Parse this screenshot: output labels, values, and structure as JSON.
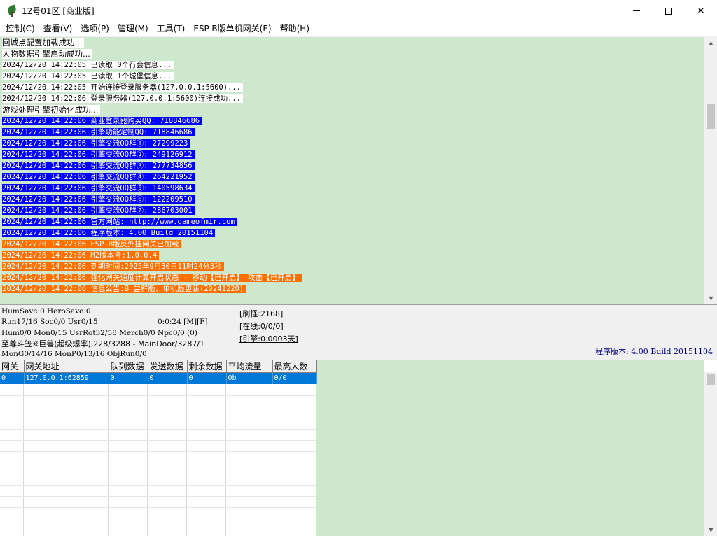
{
  "window": {
    "title": "12号01区 [商业版]",
    "app_icon": "tree-leaf-icon",
    "controls": {
      "minimize": "minimize-icon",
      "maximize": "maximize-icon",
      "close": "✕"
    }
  },
  "menu": {
    "items": [
      "控制(C)",
      "查看(V)",
      "选项(P)",
      "管理(M)",
      "工具(T)",
      "ESP-B版单机网关(E)",
      "帮助(H)"
    ]
  },
  "colors": {
    "log_background": "#cde8cd",
    "highlight_blue": "#0000ff",
    "highlight_orange": "#ff6f00",
    "selection": "#0078d7",
    "version_text": "#00007f"
  },
  "log": {
    "lines": [
      {
        "text": "回城点配置加载成功...",
        "style": "white"
      },
      {
        "text": "人物数据引擎启动成功...",
        "style": "white"
      },
      {
        "text": "2024/12/20 14:22:05 已读取 0个行会信息...",
        "style": "white"
      },
      {
        "text": "2024/12/20 14:22:05 已读取 1个城堡信息...",
        "style": "white"
      },
      {
        "text": "2024/12/20 14:22:05 开始连接登录服务器(127.0.0.1:5600)...",
        "style": "white"
      },
      {
        "text": "2024/12/20 14:22:06 登录服务器(127.0.0.1:5600)连接成功...",
        "style": "white"
      },
      {
        "text": "游戏处理引擎初始化成功...",
        "style": "white"
      },
      {
        "text": "2024/12/20 14:22:06 商业登录器购买QQ: 718846686",
        "style": "blue"
      },
      {
        "text": "2024/12/20 14:22:06 引擎功能定制QQ: 718846686",
        "style": "blue"
      },
      {
        "text": "2024/12/20 14:22:06 引擎交流QQ群①: 27299223",
        "style": "blue"
      },
      {
        "text": "2024/12/20 14:22:06 引擎交流QQ群②: 249126912",
        "style": "blue"
      },
      {
        "text": "2024/12/20 14:22:06 引擎交流QQ群③: 277734856",
        "style": "blue"
      },
      {
        "text": "2024/12/20 14:22:06 引擎交流QQ群④: 264221952",
        "style": "blue"
      },
      {
        "text": "2024/12/20 14:22:06 引擎交流QQ群⑤: 140598634",
        "style": "blue"
      },
      {
        "text": "2024/12/20 14:22:06 引擎交流QQ群⑥: 122209510",
        "style": "blue"
      },
      {
        "text": "2024/12/20 14:22:06 引擎交流QQ群⑦: 286703001",
        "style": "blue"
      },
      {
        "text": "2024/12/20 14:22:06 官方网站: http://www.gameofmir.com",
        "style": "blue"
      },
      {
        "text": "2024/12/20 14:22:06 程序版本: 4.00 Build 20151104",
        "style": "blue"
      },
      {
        "text": "2024/12/20 14:22:06 ESP-B版反外挂网关已加载",
        "style": "orange"
      },
      {
        "text": "2024/12/20 14:22:06 M2版本号:1.0.0.4",
        "style": "orange"
      },
      {
        "text": "2024/12/20 14:22:06 到期时间:2025年9月30日11时24分3秒",
        "style": "orange"
      },
      {
        "text": "2024/12/20 14:22:06 强化网关速度计算开启状态 - 移动【已开启】 攻击【已开启】",
        "style": "orange"
      },
      {
        "text": "2024/12/20 14:22:06 信息公告:B 尝鲜版、单机版更新(20241220)",
        "style": "orange"
      }
    ]
  },
  "status": {
    "line1": "HumSave:0 HeroSave:0",
    "line2a": "Run17/16 Soc0/0 Usr0/15",
    "line2b": "0:0:24 [M][F]",
    "line3": "Hum0/0 Mon0/15 UsrRot32/58 Merch0/0 Npc0/0 (0)",
    "line4": "至尊斗笠※巨兽(超级爆率),228/3288 - MainDoor/3287/1",
    "line5": "MonG0/14/16 MonP0/13/16 ObjRun0/0",
    "refresh_monsters": "[刷怪:2168]",
    "online": "[在线:0/0/0]",
    "engine": "[引擎:0.0003天]",
    "version": "程序版本: 4.00 Build 20151104"
  },
  "grid": {
    "columns": [
      "网关",
      "网关地址",
      "队列数据",
      "发送数据",
      "剩余数据",
      "平均流量",
      "最高人数"
    ],
    "rows": [
      [
        "0",
        "127.0.0.1:62859",
        "0",
        "0",
        "0",
        "0b",
        "0/0"
      ]
    ]
  }
}
